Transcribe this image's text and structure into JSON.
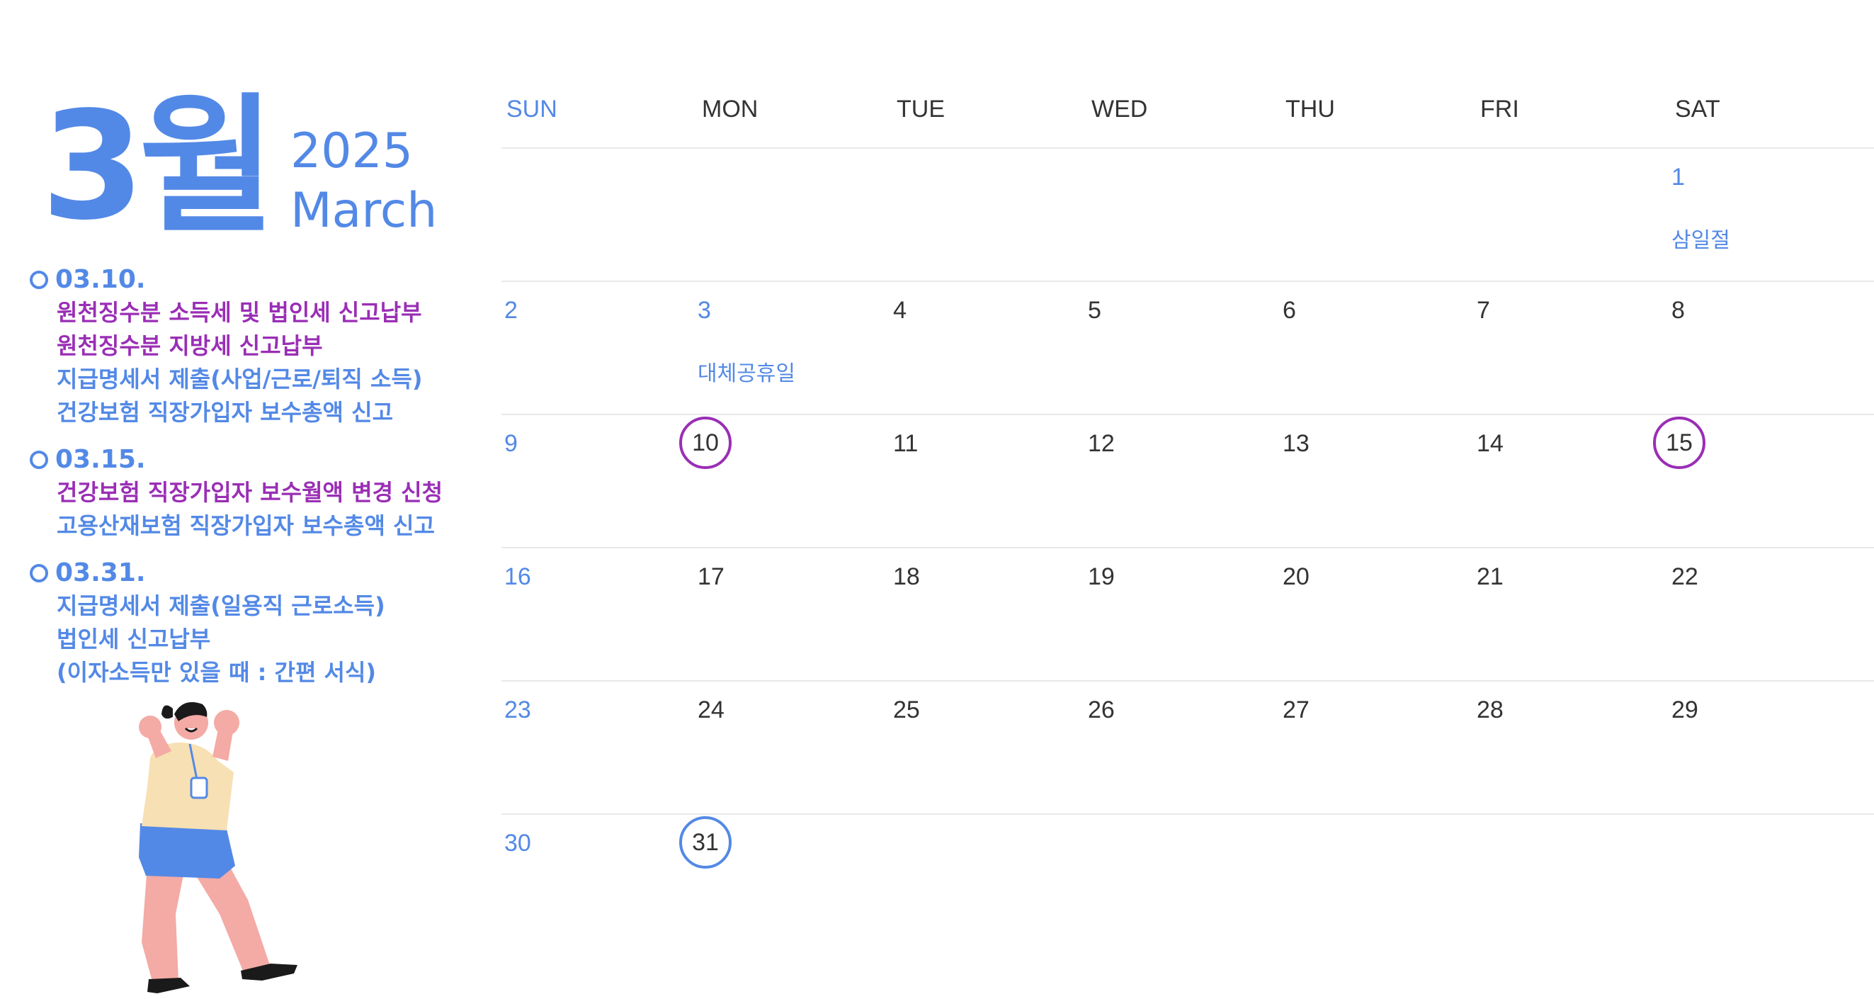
{
  "header": {
    "month_kr": "3월",
    "year": "2025",
    "month_en": "March"
  },
  "schedule": [
    {
      "date": "03.10.",
      "items": [
        {
          "text": "원천징수분 소득세 및 법인세 신고납부",
          "color": "#9a2eb5"
        },
        {
          "text": "원천징수분 지방세 신고납부",
          "color": "#9a2eb5"
        },
        {
          "text": "지급명세서 제출(사업/근로/퇴직 소득)",
          "color": "#5389e6"
        },
        {
          "text": "건강보험 직장가입자 보수총액 신고",
          "color": "#5389e6"
        }
      ]
    },
    {
      "date": "03.15.",
      "items": [
        {
          "text": "건강보험 직장가입자 보수월액 변경 신청",
          "color": "#9a2eb5"
        },
        {
          "text": "고용산재보험 직장가입자 보수총액 신고",
          "color": "#5389e6"
        }
      ]
    },
    {
      "date": "03.31.",
      "items": [
        {
          "text": "지급명세서 제출(일용직 근로소득)",
          "color": "#5389e6"
        },
        {
          "text": "법인세 신고납부",
          "color": "#5389e6"
        },
        {
          "text": "(이자소득만 있을 때 : 간편 서식)",
          "color": "#5389e6"
        }
      ]
    }
  ],
  "calendar": {
    "weekdays": [
      "SUN",
      "MON",
      "TUE",
      "WED",
      "THU",
      "FRI",
      "SAT"
    ],
    "weeks": [
      [
        null,
        null,
        null,
        null,
        null,
        null,
        {
          "day": "1",
          "holiday": "삼일절"
        }
      ],
      [
        {
          "day": "2"
        },
        {
          "day": "3",
          "holiday": "대체공휴일"
        },
        {
          "day": "4"
        },
        {
          "day": "5"
        },
        {
          "day": "6"
        },
        {
          "day": "7"
        },
        {
          "day": "8"
        }
      ],
      [
        {
          "day": "9"
        },
        {
          "day": "10",
          "circle": "purple"
        },
        {
          "day": "11"
        },
        {
          "day": "12"
        },
        {
          "day": "13"
        },
        {
          "day": "14"
        },
        {
          "day": "15",
          "circle": "purple"
        }
      ],
      [
        {
          "day": "16"
        },
        {
          "day": "17"
        },
        {
          "day": "18"
        },
        {
          "day": "19"
        },
        {
          "day": "20"
        },
        {
          "day": "21"
        },
        {
          "day": "22"
        }
      ],
      [
        {
          "day": "23"
        },
        {
          "day": "24"
        },
        {
          "day": "25"
        },
        {
          "day": "26"
        },
        {
          "day": "27"
        },
        {
          "day": "28"
        },
        {
          "day": "29"
        }
      ],
      [
        {
          "day": "30"
        },
        {
          "day": "31",
          "circle": "blue"
        },
        null,
        null,
        null,
        null,
        null
      ]
    ]
  },
  "colors": {
    "accent_blue": "#5389e6",
    "accent_purple": "#9a2eb5",
    "text_dark": "#333333",
    "grid_line": "#e8e8e8"
  },
  "illustration": {
    "icon": "woman-cheering-illustration"
  }
}
